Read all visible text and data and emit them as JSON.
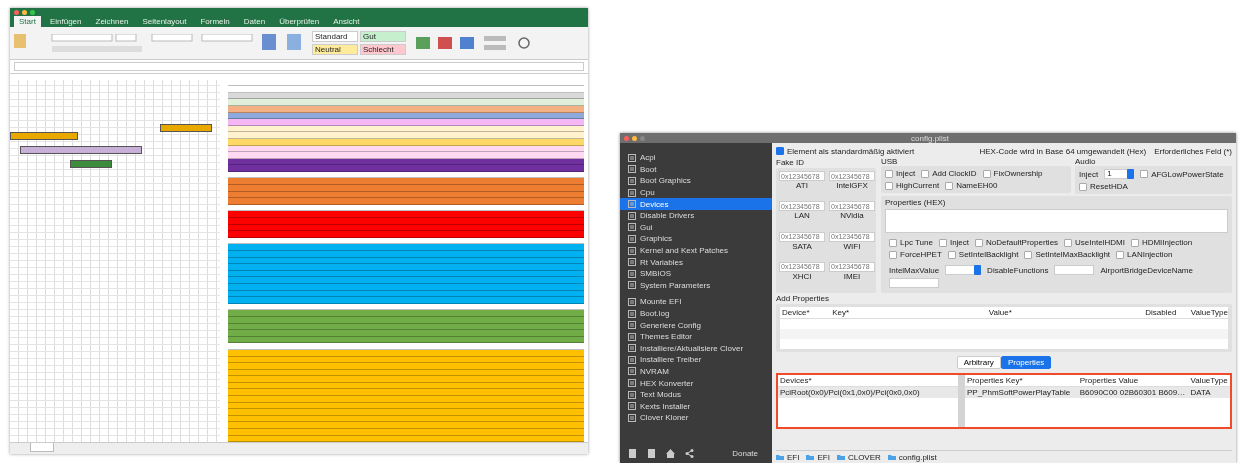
{
  "excel": {
    "ribbon_tabs": [
      {
        "label": "Start",
        "selected": true
      },
      {
        "label": "Einfügen",
        "selected": false
      },
      {
        "label": "Zeichnen",
        "selected": false
      },
      {
        "label": "Seitenlayout",
        "selected": false
      },
      {
        "label": "Formeln",
        "selected": false
      },
      {
        "label": "Daten",
        "selected": false
      },
      {
        "label": "Überprüfen",
        "selected": false
      },
      {
        "label": "Ansicht",
        "selected": false
      }
    ],
    "styles": [
      {
        "label": "Standard",
        "color": "#ffffff"
      },
      {
        "label": "Gut",
        "color": "#c6efce"
      },
      {
        "label": "Neutral",
        "color": "#ffeb9c"
      },
      {
        "label": "Schlecht",
        "color": "#ffc7ce"
      }
    ],
    "sheet_rows": [
      {
        "color": "#ffffff"
      },
      {
        "color": "#ffffff"
      },
      {
        "color": "#d9d9d9"
      },
      {
        "color": "#e2efda"
      },
      {
        "color": "#f4b183"
      },
      {
        "color": "#8ea9db"
      },
      {
        "color": "#f4b6f4"
      },
      {
        "color": "#fff2cc"
      },
      {
        "color": "#fff2cc"
      },
      {
        "color": "#ffd966"
      },
      {
        "color": "#ffd9f2"
      },
      {
        "color": "#ffd9f2"
      },
      {
        "color": "#7030a0"
      },
      {
        "color": "#7030a0"
      },
      {
        "color": "#ffffff"
      },
      {
        "color": "#ed7d31"
      },
      {
        "color": "#ed7d31"
      },
      {
        "color": "#ed7d31"
      },
      {
        "color": "#ed7d31"
      },
      {
        "color": "#ffffff"
      },
      {
        "color": "#ff0000"
      },
      {
        "color": "#ff0000"
      },
      {
        "color": "#ff0000"
      },
      {
        "color": "#ff0000"
      },
      {
        "color": "#ffffff"
      },
      {
        "color": "#00b0f0"
      },
      {
        "color": "#00b0f0"
      },
      {
        "color": "#00b0f0"
      },
      {
        "color": "#00b0f0"
      },
      {
        "color": "#00b0f0"
      },
      {
        "color": "#00b0f0"
      },
      {
        "color": "#00b0f0"
      },
      {
        "color": "#00b0f0"
      },
      {
        "color": "#00b0f0"
      },
      {
        "color": "#ffffff"
      },
      {
        "color": "#70ad47"
      },
      {
        "color": "#70ad47"
      },
      {
        "color": "#70ad47"
      },
      {
        "color": "#70ad47"
      },
      {
        "color": "#70ad47"
      },
      {
        "color": "#ffffff"
      },
      {
        "color": "#ffc000"
      },
      {
        "color": "#ffc000"
      },
      {
        "color": "#ffc000"
      },
      {
        "color": "#ffc000"
      },
      {
        "color": "#ffc000"
      },
      {
        "color": "#ffc000"
      },
      {
        "color": "#ffc000"
      },
      {
        "color": "#ffc000"
      },
      {
        "color": "#ffc000"
      },
      {
        "color": "#ffc000"
      },
      {
        "color": "#ffc000"
      },
      {
        "color": "#ffc000"
      },
      {
        "color": "#ffc000"
      },
      {
        "color": "#ffc000"
      }
    ]
  },
  "app": {
    "window": {
      "title": "config.plist"
    },
    "sidebar": {
      "sections": [
        {
          "items": [
            {
              "label": "Acpi",
              "selected": false
            },
            {
              "label": "Boot",
              "selected": false
            },
            {
              "label": "Boot Graphics",
              "selected": false
            },
            {
              "label": "Cpu",
              "selected": false
            },
            {
              "label": "Devices",
              "selected": true
            },
            {
              "label": "Disable Drivers",
              "selected": false
            },
            {
              "label": "Gui",
              "selected": false
            },
            {
              "label": "Graphics",
              "selected": false
            },
            {
              "label": "Kernel and Kext Patches",
              "selected": false
            },
            {
              "label": "Rt Variables",
              "selected": false
            },
            {
              "label": "SMBIOS",
              "selected": false
            },
            {
              "label": "System Parameters",
              "selected": false
            }
          ]
        },
        {
          "items": [
            {
              "label": "Mounte EFI",
              "selected": false
            },
            {
              "label": "Boot.log",
              "selected": false
            },
            {
              "label": "Generiere Config",
              "selected": false
            },
            {
              "label": "Themes Editor",
              "selected": false
            },
            {
              "label": "Installiere/Aktualisiere Clover",
              "selected": false
            },
            {
              "label": "Installiere Treiber",
              "selected": false
            },
            {
              "label": "NVRAM",
              "selected": false
            },
            {
              "label": "HEX Konverter",
              "selected": false
            },
            {
              "label": "Text Modus",
              "selected": false
            },
            {
              "label": "Kexts Installer",
              "selected": false
            },
            {
              "label": "Clover Kloner",
              "selected": false
            }
          ]
        }
      ],
      "donate": "Donate"
    },
    "top": {
      "check": {
        "label": "Element als standardmäßig aktiviert",
        "checked": true
      },
      "hex_note": "HEX-Code wird in Base 64 umgewandelt (Hex)",
      "required_note": "Erforderliches Feld (*)"
    },
    "fake_id": {
      "title": "Fake ID",
      "fields": [
        {
          "label": "ATI",
          "placeholder": "0x12345678"
        },
        {
          "label": "IntelGFX",
          "placeholder": "0x12345678"
        },
        {
          "label": "LAN",
          "placeholder": "0x12345678"
        },
        {
          "label": "NVidia",
          "placeholder": "0x12345678"
        },
        {
          "label": "SATA",
          "placeholder": "0x12345678"
        },
        {
          "label": "WIFI",
          "placeholder": "0x12345678"
        },
        {
          "label": "XHCI",
          "placeholder": "0x12345678"
        },
        {
          "label": "IMEI",
          "placeholder": "0x12345678"
        }
      ]
    },
    "usb": {
      "title": "USB",
      "checks": [
        {
          "label": "Inject",
          "checked": false
        },
        {
          "label": "Add ClockID",
          "checked": false
        },
        {
          "label": "FixOwnership",
          "checked": false
        },
        {
          "label": "HighCurrent",
          "checked": false
        },
        {
          "label": "NameEH00",
          "checked": false
        }
      ]
    },
    "audio": {
      "title": "Audio",
      "inject_label": "Inject",
      "inject_value": "1",
      "checks": [
        {
          "label": "AFGLowPowerState",
          "checked": false
        },
        {
          "label": "ResetHDA",
          "checked": false
        }
      ]
    },
    "properties_hex": {
      "title": "Properties (HEX)",
      "checks": [
        {
          "label": "Lpc Tune",
          "checked": false
        },
        {
          "label": "Inject",
          "checked": false
        },
        {
          "label": "NoDefaultProperties",
          "checked": false
        },
        {
          "label": "UseIntelHDMI",
          "checked": false
        },
        {
          "label": "HDMIInjection",
          "checked": false
        },
        {
          "label": "ForceHPET",
          "checked": false
        },
        {
          "label": "SetIntelBacklight",
          "checked": false
        },
        {
          "label": "SetIntelMaxBacklight",
          "checked": false
        },
        {
          "label": "LANInjection",
          "checked": false
        }
      ],
      "intel_max_label": "IntelMaxValue",
      "disable_label": "DisableFunctions",
      "airport_label": "AirportBridgeDeviceName"
    },
    "add_properties": {
      "title": "Add Properties",
      "columns": [
        "Device*",
        "Key*",
        "Value*",
        "Disabled",
        "ValueType"
      ]
    },
    "tabs": [
      {
        "label": "Arbitrary",
        "selected": false
      },
      {
        "label": "Properties",
        "selected": true
      }
    ],
    "devices_table": {
      "columns": [
        "Devices*"
      ],
      "rows": [
        {
          "device": "PciRoot(0x0)/Pci(0x1,0x0)/Pci(0x0,0x0)"
        }
      ]
    },
    "properties_table": {
      "columns": [
        "Properties Key*",
        "Properties Value",
        "ValueType"
      ],
      "rows": [
        {
          "key": "PP_PhmSoftPowerPlayTable",
          "value": "B6090C00 02B60301 B609…",
          "type": "DATA"
        }
      ]
    },
    "path": [
      "EFI",
      "EFI",
      "CLOVER",
      "config.plist"
    ]
  }
}
